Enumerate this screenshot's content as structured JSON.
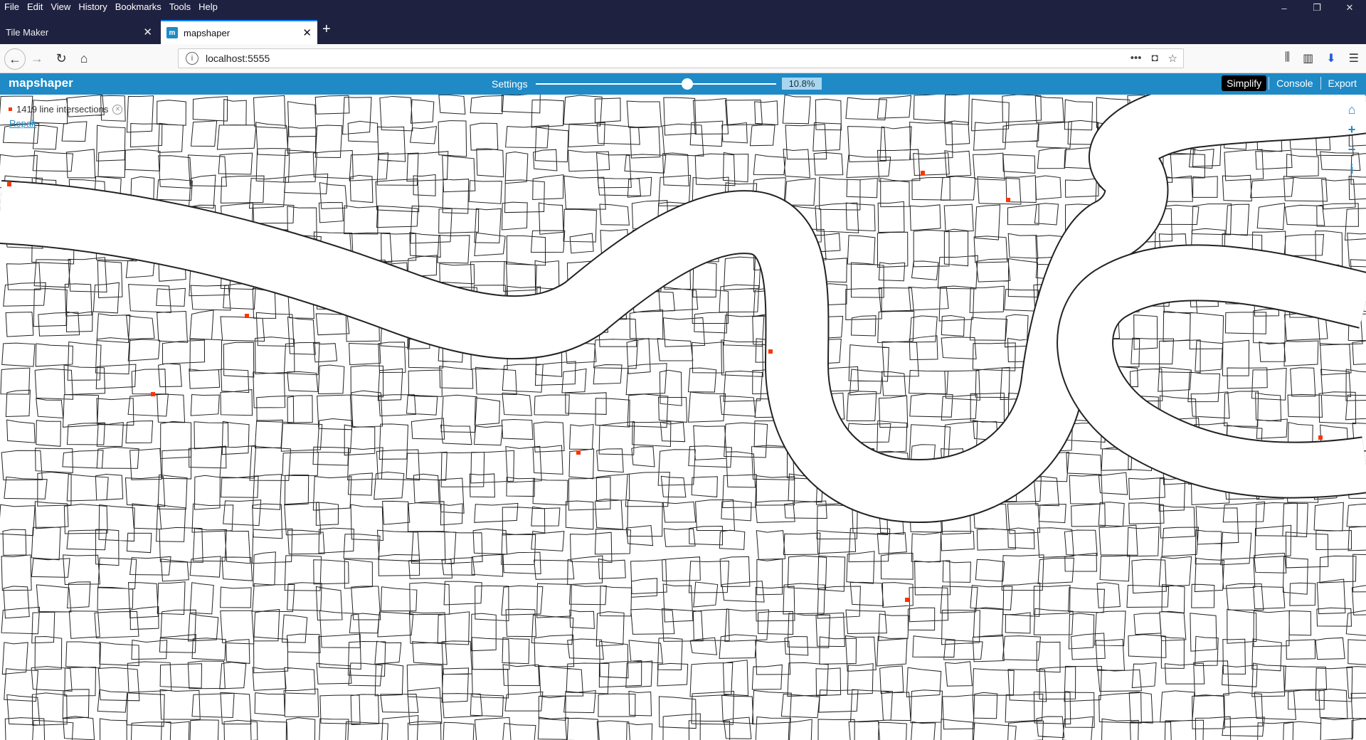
{
  "menu": [
    "File",
    "Edit",
    "View",
    "History",
    "Bookmarks",
    "Tools",
    "Help"
  ],
  "tabs": [
    {
      "label": "Tile Maker",
      "active": false
    },
    {
      "label": "mapshaper",
      "active": true
    }
  ],
  "url": "localhost:5555",
  "app": {
    "logo": "mapshaper",
    "settings_label": "Settings",
    "simplify_pct": "10.8%",
    "simplify_fraction": 0.108,
    "buttons": {
      "simplify": "Simplify",
      "console": "Console",
      "export": "Export"
    }
  },
  "notice": {
    "text": "1419 line intersections",
    "repair": "Repair"
  },
  "colors": {
    "header": "#1f8ac6",
    "intersection": "#ff3300",
    "titlebar": "#1f2140"
  },
  "icons": [
    "home-icon",
    "zoom-in-icon",
    "zoom-out-icon",
    "info-icon"
  ]
}
